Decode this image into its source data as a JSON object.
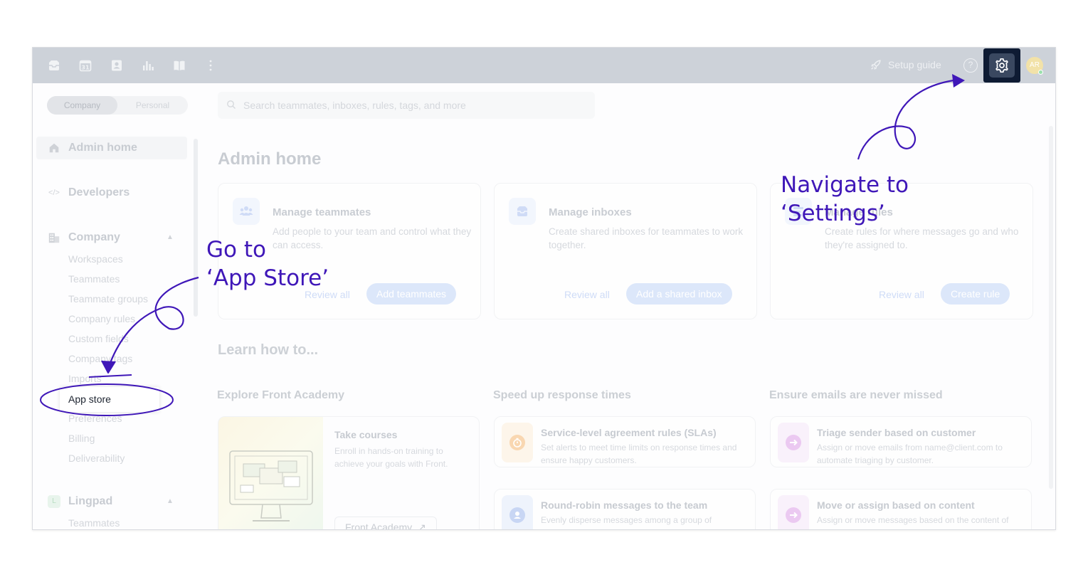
{
  "topbar": {
    "icons": [
      "inbox-icon",
      "calendar-icon",
      "contacts-icon",
      "analytics-icon",
      "book-icon",
      "more-icon"
    ],
    "calendar_day": "31",
    "setup_guide": "Setup guide",
    "help": "?",
    "avatar": "AR"
  },
  "sidebar": {
    "segment": {
      "company": "Company",
      "personal": "Personal"
    },
    "admin_home": "Admin home",
    "developers": "Developers",
    "developers_icon": "</>",
    "company": "Company",
    "company_items": [
      "Workspaces",
      "Teammates",
      "Teammate groups",
      "Company rules",
      "Custom fields",
      "Company tags",
      "Imports",
      "App store",
      "Preferences",
      "Billing",
      "Deliverability"
    ],
    "lingpad": "Lingpad",
    "lingpad_badge": "L",
    "lingpad_items": [
      "Teammates"
    ]
  },
  "search": {
    "placeholder": "Search teammates, inboxes, rules, tags, and more"
  },
  "main": {
    "title": "Admin home",
    "cards": [
      {
        "title": "Manage teammates",
        "desc": "Add people to your team and control what they can access.",
        "link": "Review all",
        "button": "Add teammates"
      },
      {
        "title": "Manage inboxes",
        "desc": "Create shared inboxes for teammates to work together.",
        "link": "Review all",
        "button": "Add a shared inbox"
      },
      {
        "title": "Manage rules",
        "desc": "Create rules for where messages go and who they're assigned to.",
        "link": "Review all",
        "button": "Create rule"
      }
    ],
    "learn_title": "Learn how to...",
    "columns": [
      "Explore Front Academy",
      "Speed up response times",
      "Ensure emails are never missed"
    ],
    "academy": {
      "title": "Take courses",
      "desc": "Enroll in hands-on training to achieve your goals with Front.",
      "link": "Front Academy"
    },
    "tips": [
      {
        "title": "Service-level agreement rules (SLAs)",
        "desc": "Set alerts to meet time limits on response times and ensure happy customers."
      },
      {
        "title": "Round-robin messages to the team",
        "desc": "Evenly disperse messages among a group of"
      },
      {
        "title": "Triage sender based on customer",
        "desc": "Assign or move emails from name@client.com to automate triaging by customer."
      },
      {
        "title": "Move or assign based on content",
        "desc": "Assign or move messages based on the content of"
      }
    ]
  },
  "annotations": {
    "settings": [
      "Navigate to",
      "‘Settings’"
    ],
    "appstore": [
      "Go to",
      "‘App Store’"
    ]
  },
  "colors": {
    "annotation": "#3f17b8",
    "settings_highlight": "#0e1b33"
  }
}
